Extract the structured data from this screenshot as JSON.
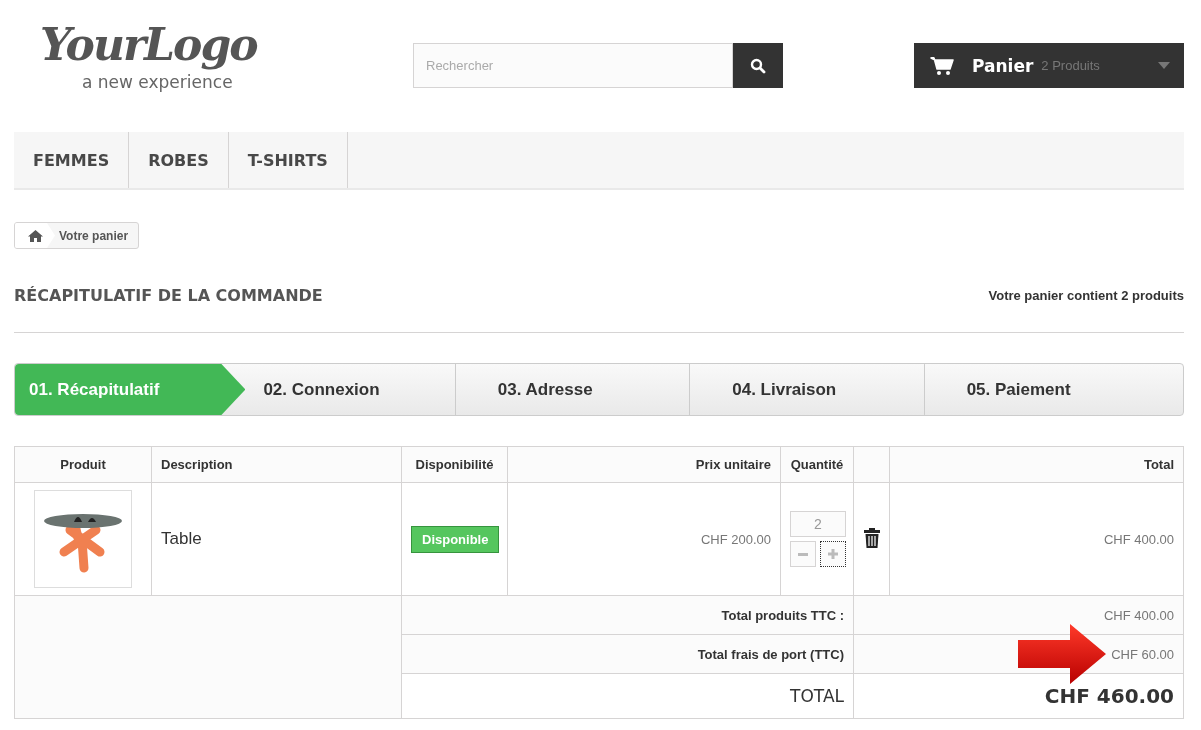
{
  "logo": {
    "name": "YourLogo",
    "tagline": "a new experience"
  },
  "search": {
    "placeholder": "Rechercher"
  },
  "cart": {
    "label": "Panier",
    "count": "2 Produits"
  },
  "nav": [
    {
      "label": "FEMMES"
    },
    {
      "label": "ROBES"
    },
    {
      "label": "T-SHIRTS"
    }
  ],
  "breadcrumb": {
    "current": "Votre panier"
  },
  "heading": {
    "title": "RÉCAPITULATIF DE LA COMMANDE",
    "summary": "Votre panier contient 2 produits"
  },
  "steps": [
    {
      "label": "01. Récapitulatif",
      "selected": true
    },
    {
      "label": "02. Connexion",
      "selected": false
    },
    {
      "label": "03. Adresse",
      "selected": false
    },
    {
      "label": "04. Livraison",
      "selected": false
    },
    {
      "label": "05. Paiement",
      "selected": false
    }
  ],
  "table": {
    "columns": [
      "Produit",
      "Description",
      "Disponibilité",
      "Prix unitaire",
      "Quantité",
      "Total"
    ],
    "rows": [
      {
        "description": "Table",
        "availability": "Disponible",
        "unit_price": "CHF 200.00",
        "quantity": "2",
        "total": "CHF 400.00"
      }
    ],
    "summary": [
      {
        "kind": "line",
        "label": "Total produits TTC :",
        "value": "CHF 400.00",
        "highlighted": false
      },
      {
        "kind": "line",
        "label": "Total frais de port (TTC)",
        "value": "CHF 60.00",
        "highlighted": true
      },
      {
        "kind": "grand",
        "label": "TOTAL",
        "value": "CHF 460.00",
        "highlighted": false
      }
    ]
  }
}
